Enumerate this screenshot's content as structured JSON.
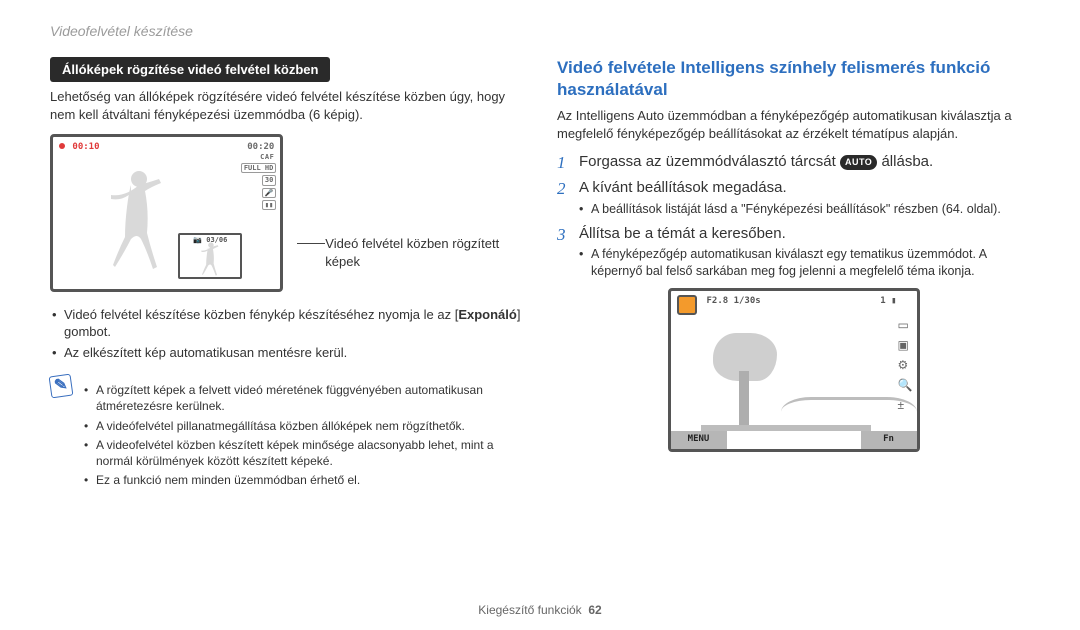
{
  "breadcrumb": "Videofelvétel készítése",
  "footer": {
    "label": "Kiegészítő funkciók",
    "page": "62"
  },
  "left": {
    "header_pill": "Állóképek rögzítése videó felvétel közben",
    "intro": "Lehetőség van állóképek rögzítésére videó felvétel készítése közben úgy, hogy nem kell átváltani fényképezési üzemmódba (6 képig).",
    "lcd": {
      "rec_time": "00:10",
      "limit_time": "00:20",
      "caf": "CAF",
      "full_hd": "FULL HD",
      "fps": "30",
      "thumb_label": "03/06"
    },
    "callout": "Videó felvétel közben rögzített képek",
    "bullets": [
      {
        "prefix": "Videó felvétel készítése közben fénykép készítéséhez nyomja le az [",
        "bold": "Exponáló",
        "suffix": "] gombot."
      },
      {
        "text": "Az elkészített kép automatikusan mentésre kerül."
      }
    ],
    "note": [
      "A rögzített képek a felvett videó méretének függvényében automatikusan átméretezésre kerülnek.",
      "A videófelvétel pillanatmegállítása közben állóképek nem rögzíthetők.",
      "A videofelvétel közben készített képek minősége alacsonyabb lehet, mint a normál körülmények között készített képeké.",
      "Ez a funkció nem minden üzemmódban érhető el."
    ]
  },
  "right": {
    "h2": "Videó felvétele Intelligens színhely felismerés funkció használatával",
    "intro": "Az Intelligens Auto üzemmódban a fényképezőgép automatikusan kiválasztja a megfelelő fényképezőgép beállításokat az érzékelt tématípus alapján.",
    "auto_chip": "AUTO",
    "steps": [
      {
        "title_before": "Forgassa az üzemmódválasztó tárcsát ",
        "title_after": " állásba."
      },
      {
        "title": "A kívánt beállítások megadása.",
        "sub": [
          "A beállítások listáját lásd a \"Fényképezési beállítások\" részben (64. oldal)."
        ]
      },
      {
        "title": "Állítsa be a témát a keresőben.",
        "sub": [
          "A fényképezőgép automatikusan kiválaszt egy tematikus üzemmódot. A képernyő bal felső sarkában meg fog jelenni a megfelelő téma ikonja."
        ]
      }
    ],
    "lcd": {
      "exposure": "F2.8 1/30s",
      "count": "1",
      "menu": "MENU",
      "fn": "Fn"
    }
  }
}
